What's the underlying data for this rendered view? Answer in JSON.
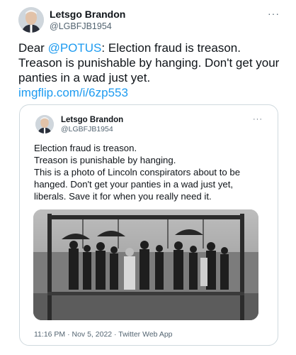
{
  "tweet": {
    "author_name": "Letsgo Brandon",
    "author_handle": "@LGBFJB1954",
    "text_prefix": "Dear ",
    "mention": "@POTUS",
    "text_suffix": ": Election fraud is treason. Treason is punishable by hanging. Don't get your panties in a wad just yet.",
    "link": "imgflip.com/i/6zp553",
    "more_icon": "more-dots-icon"
  },
  "quote": {
    "author_name": "Letsgo Brandon",
    "author_handle": "@LGBFJB1954",
    "text": "Election fraud is treason.\nTreason is punishable by hanging.\nThis is a photo of Lincoln conspirators about to be hanged. Don't get your panties in a wad just yet, liberals. Save it for when you really need it.",
    "timestamp": "11:16 PM · Nov 5, 2022 · Twitter Web App",
    "more_icon": "more-dots-icon"
  }
}
